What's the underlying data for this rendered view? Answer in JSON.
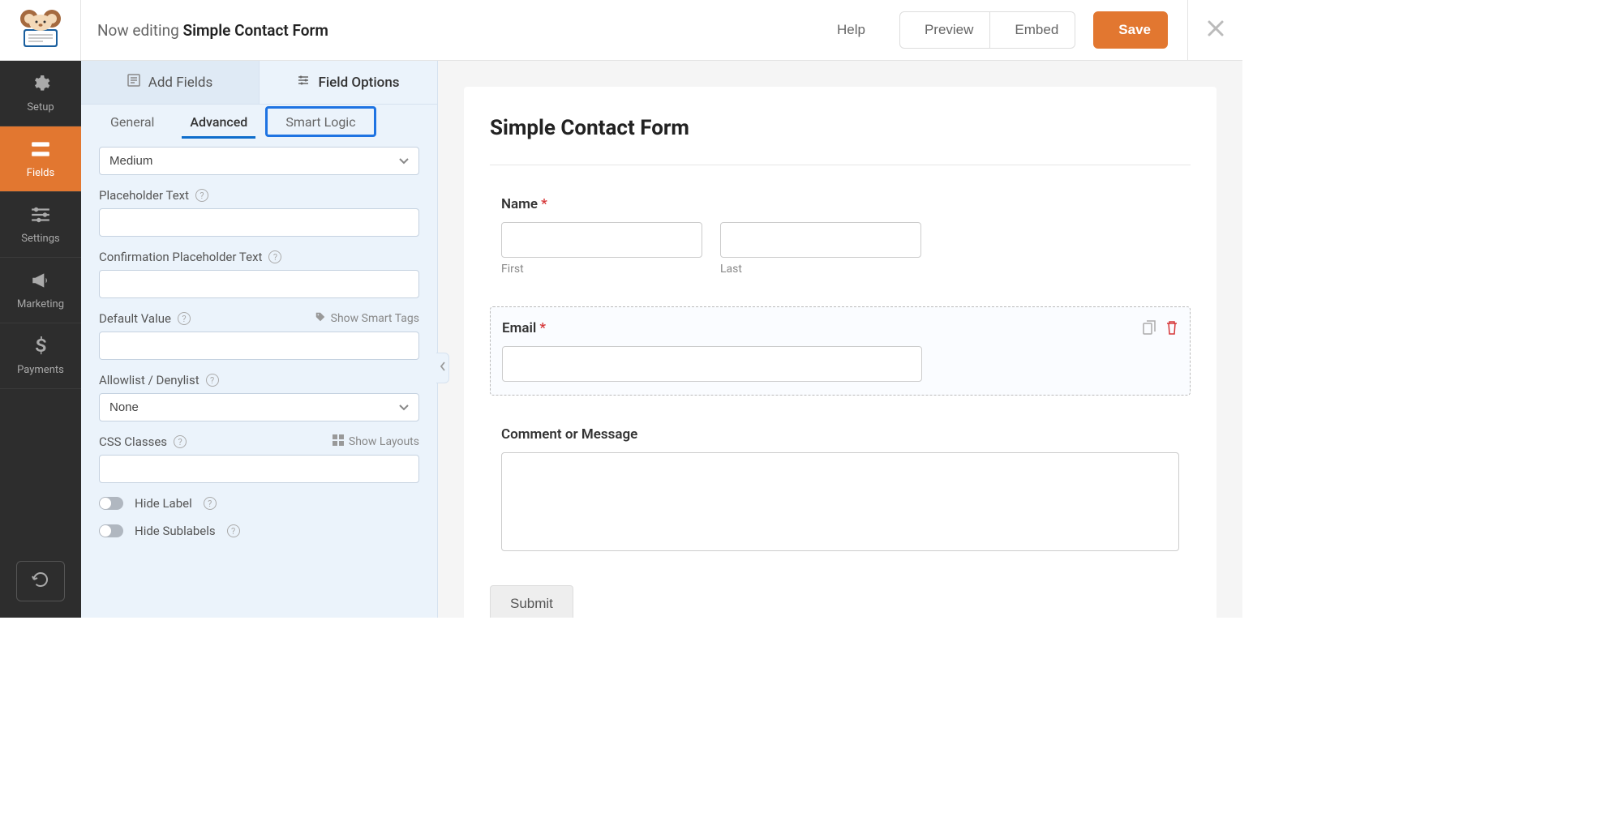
{
  "header": {
    "editing_prefix": "Now editing",
    "form_name": "Simple Contact Form",
    "help_label": "Help",
    "preview_label": "Preview",
    "embed_label": "Embed",
    "save_label": "Save"
  },
  "sidebar": {
    "items": [
      {
        "label": "Setup"
      },
      {
        "label": "Fields"
      },
      {
        "label": "Settings"
      },
      {
        "label": "Marketing"
      },
      {
        "label": "Payments"
      }
    ]
  },
  "panel": {
    "top_tabs": {
      "add_fields": "Add Fields",
      "field_options": "Field Options"
    },
    "sub_tabs": {
      "general": "General",
      "advanced": "Advanced",
      "smart_logic": "Smart Logic"
    },
    "size_value": "Medium",
    "placeholder_label": "Placeholder Text",
    "confirmation_placeholder_label": "Confirmation Placeholder Text",
    "default_value_label": "Default Value",
    "smart_tags_label": "Show Smart Tags",
    "allowlist_label": "Allowlist / Denylist",
    "allowlist_value": "None",
    "css_label": "CSS Classes",
    "layouts_label": "Show Layouts",
    "hide_label": "Hide Label",
    "hide_sublabels": "Hide Sublabels"
  },
  "preview": {
    "title": "Simple Contact Form",
    "name_label": "Name",
    "first_sublabel": "First",
    "last_sublabel": "Last",
    "email_label": "Email",
    "comment_label": "Comment or Message",
    "submit_label": "Submit"
  }
}
